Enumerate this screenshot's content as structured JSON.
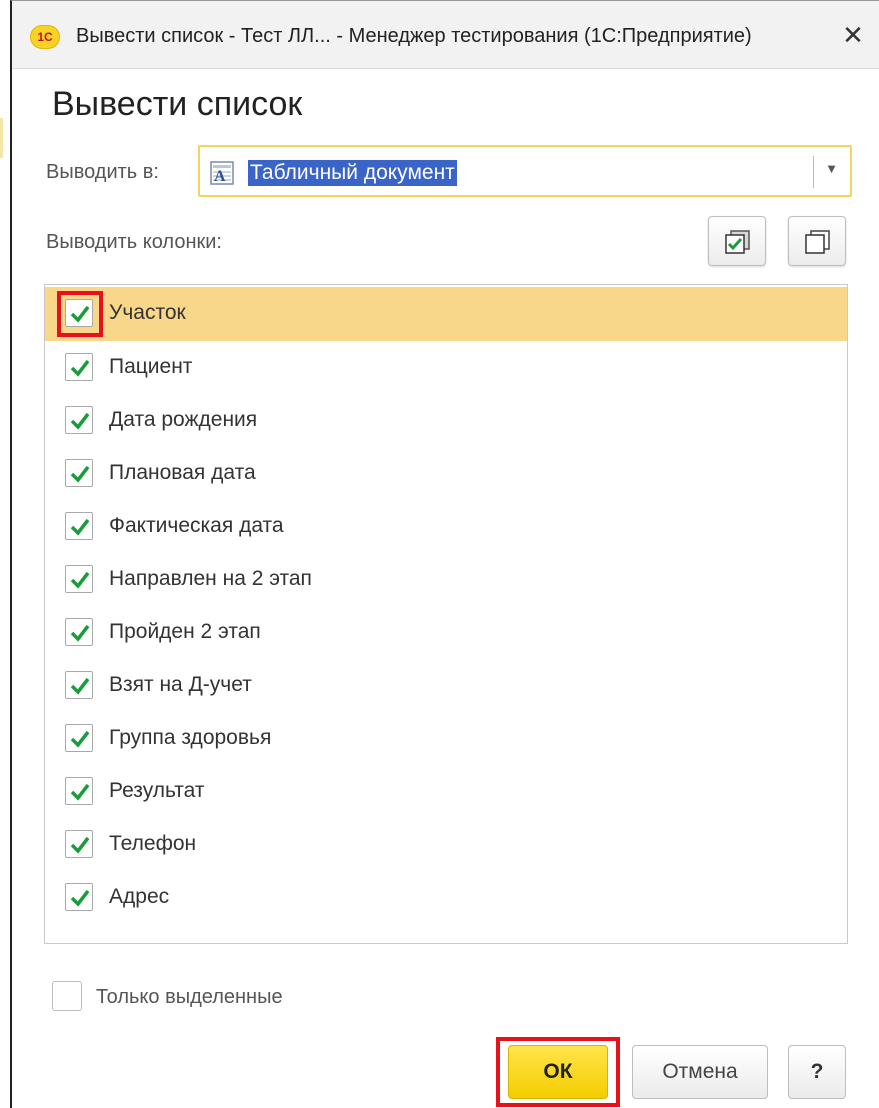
{
  "window": {
    "app_logo": "1С",
    "title": "Вывести список - Тест ЛЛ... - Менеджер тестирования (1С:Предприятие)",
    "close_glyph": "✕"
  },
  "form": {
    "title": "Вывести список"
  },
  "output": {
    "label": "Выводить в:",
    "value": "Табличный документ",
    "icon": "spreadsheet-document-icon",
    "dropdown_glyph": "▼"
  },
  "columns": {
    "label": "Выводить колонки:",
    "check_all_icon": "check-all-icon",
    "uncheck_all_icon": "uncheck-all-icon",
    "items": [
      {
        "label": "Участок",
        "checked": true
      },
      {
        "label": "Пациент",
        "checked": true
      },
      {
        "label": "Дата рождения",
        "checked": true
      },
      {
        "label": "Плановая дата",
        "checked": true
      },
      {
        "label": "Фактическая дата",
        "checked": true
      },
      {
        "label": "Направлен на 2 этап",
        "checked": true
      },
      {
        "label": "Пройден 2 этап",
        "checked": true
      },
      {
        "label": "Взят на Д-учет",
        "checked": true
      },
      {
        "label": "Группа здоровья",
        "checked": true
      },
      {
        "label": "Результат",
        "checked": true
      },
      {
        "label": "Телефон",
        "checked": true
      },
      {
        "label": "Адрес",
        "checked": true
      }
    ]
  },
  "only_selected": {
    "label": "Только выделенные",
    "checked": false
  },
  "buttons": {
    "ok": "ОК",
    "cancel": "Отмена",
    "help": "?"
  },
  "colors": {
    "accent_yellow": "#f4cd00",
    "selection_row": "#f9d78a",
    "check_green": "#1a9c3a",
    "highlight_red": "#e8101a",
    "input_focus": "#f4d35e",
    "text_selection": "#3a64c8"
  }
}
